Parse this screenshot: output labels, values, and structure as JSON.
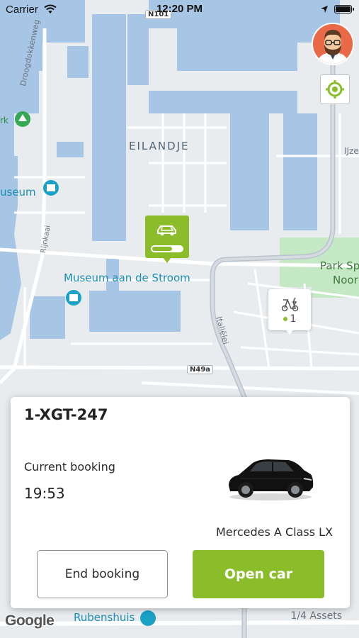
{
  "status_bar": {
    "carrier": "Carrier",
    "time": "12:20 PM"
  },
  "map": {
    "labels": {
      "eilandje": "EILANDJE",
      "museum": "useum",
      "museum_aan_de_stroom": "Museum aan de Stroom",
      "park_spoor_noord_1": "Park Sp",
      "park_spoor_noord_2": "Noor",
      "rubenshuis": "Rubenshuis",
      "droogdokkenweg": "Droogdokkenweg",
      "rijnkaai": "Rijnkaai",
      "italielei": "Italiëlei",
      "ijzer": "IJze",
      "park_left": "rk",
      "road_n101": "N101",
      "road_n49a": "N49a"
    }
  },
  "car_marker": {
    "battery_level_pct": 70
  },
  "asset_marker": {
    "count": "1"
  },
  "booking_card": {
    "plate": "1-XGT-247",
    "booking_label": "Current booking",
    "booking_time": "19:53",
    "car_model": "Mercedes A Class LX",
    "end_booking_label": "End booking",
    "open_car_label": "Open car"
  },
  "footer": {
    "google_label": "Google",
    "assets_label": "1/4 Assets"
  },
  "colors": {
    "accent": "#8bbd2a",
    "water": "#a7c5e4",
    "park": "#c5e8c5",
    "avatar_bg": "#ea6a48"
  }
}
